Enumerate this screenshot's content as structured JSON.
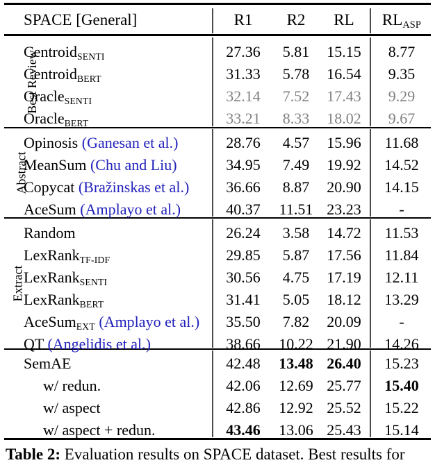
{
  "table": {
    "header": {
      "corner_label": "SPACE [General]",
      "corner_label_sc": "SPACE",
      "corner_label_rest": " [General]",
      "columns": [
        {
          "id": "r1",
          "label": "R1"
        },
        {
          "id": "r2",
          "label": "R2"
        },
        {
          "id": "rl",
          "label": "RL"
        },
        {
          "id": "rlasp",
          "label": "RL",
          "sub": "ASP"
        }
      ]
    },
    "groups": [
      {
        "name": "Best Review",
        "rows": [
          {
            "label_main": "Centroid",
            "label_sub": "SENTI",
            "label_cite": "",
            "indent": false,
            "gray": false,
            "r1": "27.36",
            "r2": "5.81",
            "rl": "15.15",
            "rlasp": "8.77",
            "bold": []
          },
          {
            "label_main": "Centroid",
            "label_sub": "BERT",
            "label_cite": "",
            "indent": false,
            "gray": false,
            "r1": "31.33",
            "r2": "5.78",
            "rl": "16.54",
            "rlasp": "9.35",
            "bold": []
          },
          {
            "label_main": "Oracle",
            "label_sub": "SENTI",
            "label_cite": "",
            "indent": false,
            "gray": true,
            "r1": "32.14",
            "r2": "7.52",
            "rl": "17.43",
            "rlasp": "9.29",
            "bold": []
          },
          {
            "label_main": "Oracle",
            "label_sub": "BERT",
            "label_cite": "",
            "indent": false,
            "gray": true,
            "r1": "33.21",
            "r2": "8.33",
            "rl": "18.02",
            "rlasp": "9.67",
            "bold": []
          }
        ]
      },
      {
        "name": "Abstract",
        "rows": [
          {
            "label_main": "Opinosis ",
            "label_sub": "",
            "label_cite": "(Ganesan et al.)",
            "indent": false,
            "gray": false,
            "r1": "28.76",
            "r2": "4.57",
            "rl": "15.96",
            "rlasp": "11.68",
            "bold": []
          },
          {
            "label_main": "MeanSum ",
            "label_sub": "",
            "label_cite": "(Chu and Liu)",
            "indent": false,
            "gray": false,
            "r1": "34.95",
            "r2": "7.49",
            "rl": "19.92",
            "rlasp": "14.52",
            "bold": []
          },
          {
            "label_main": "Copycat ",
            "label_sub": "",
            "label_cite": "(Bražinskas et al.)",
            "indent": false,
            "gray": false,
            "r1": "36.66",
            "r2": "8.87",
            "rl": "20.90",
            "rlasp": "14.15",
            "bold": []
          },
          {
            "label_main": "AceSum ",
            "label_sub": "",
            "label_cite": "(Amplayo et al.)",
            "indent": false,
            "gray": false,
            "r1": "40.37",
            "r2": "11.51",
            "rl": "23.23",
            "rlasp": "-",
            "bold": []
          }
        ]
      },
      {
        "name": "Extract",
        "rows": [
          {
            "label_main": "Random",
            "label_sub": "",
            "label_cite": "",
            "indent": false,
            "gray": false,
            "r1": "26.24",
            "r2": "3.58",
            "rl": "14.72",
            "rlasp": "11.53",
            "bold": []
          },
          {
            "label_main": "LexRank",
            "label_sub": "TF-IDF",
            "label_cite": "",
            "indent": false,
            "gray": false,
            "r1": "29.85",
            "r2": "5.87",
            "rl": "17.56",
            "rlasp": "11.84",
            "bold": []
          },
          {
            "label_main": "LexRank",
            "label_sub": "SENTI",
            "label_cite": "",
            "indent": false,
            "gray": false,
            "r1": "30.56",
            "r2": "4.75",
            "rl": "17.19",
            "rlasp": "12.11",
            "bold": []
          },
          {
            "label_main": "LexRank",
            "label_sub": "BERT",
            "label_cite": "",
            "indent": false,
            "gray": false,
            "r1": "31.41",
            "r2": "5.05",
            "rl": "18.12",
            "rlasp": "13.29",
            "bold": []
          },
          {
            "label_main": "AceSum",
            "label_sub": "EXT",
            "label_cite": " (Amplayo et al.)",
            "indent": false,
            "gray": false,
            "r1": "35.50",
            "r2": "7.82",
            "rl": "20.09",
            "rlasp": "-",
            "bold": []
          },
          {
            "label_main": "QT ",
            "label_sub": "",
            "label_cite": "(Angelidis et al.)",
            "indent": false,
            "gray": false,
            "r1": "38.66",
            "r2": "10.22",
            "rl": "21.90",
            "rlasp": "14.26",
            "bold": []
          }
        ]
      },
      {
        "name": "",
        "rows": [
          {
            "label_main": "SemAE",
            "label_sub": "",
            "label_cite": "",
            "indent": false,
            "gray": false,
            "r1": "42.48",
            "r2": "13.48",
            "rl": "26.40",
            "rlasp": "15.23",
            "bold": [
              "r2",
              "rl"
            ]
          },
          {
            "label_main": "w/ redun.",
            "label_sub": "",
            "label_cite": "",
            "indent": true,
            "gray": false,
            "r1": "42.06",
            "r2": "12.69",
            "rl": "25.77",
            "rlasp": "15.40",
            "bold": [
              "rlasp"
            ]
          },
          {
            "label_main": "w/ aspect",
            "label_sub": "",
            "label_cite": "",
            "indent": true,
            "gray": false,
            "r1": "42.86",
            "r2": "12.92",
            "rl": "25.52",
            "rlasp": "15.22",
            "bold": []
          },
          {
            "label_main": "w/ aspect + redun.",
            "label_sub": "",
            "label_cite": "",
            "indent": true,
            "gray": false,
            "r1": "43.46",
            "r2": "13.06",
            "rl": "25.43",
            "rlasp": "15.14",
            "bold": [
              "r1"
            ]
          }
        ]
      }
    ]
  },
  "caption": {
    "prefix": "Table 2:",
    "text_before_sc": " Evaluation results on ",
    "sc": "SPACE",
    "text_after_sc": " dataset. Best results for"
  },
  "colors": {
    "citation_blue": "#2222bb",
    "muted_gray": "#808080",
    "rule_black": "#000000"
  }
}
